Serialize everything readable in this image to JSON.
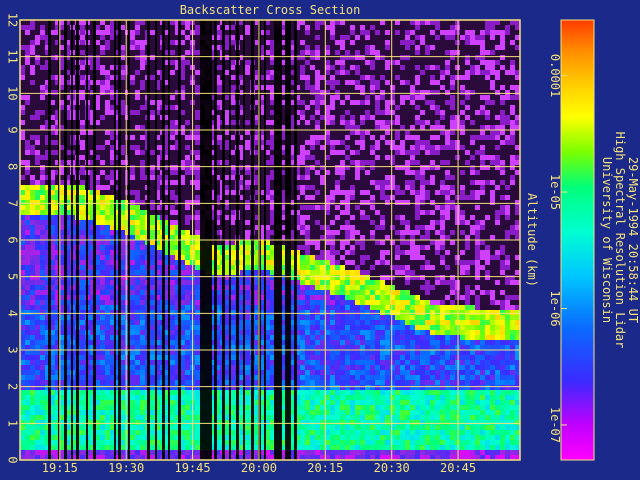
{
  "chart_data": {
    "type": "heatmap",
    "title": "Backscatter Cross Section",
    "ylabel": "Altitude (km)",
    "y_ticks": [
      "0",
      "1",
      "2",
      "3",
      "4",
      "5",
      "6",
      "7",
      "8",
      "9",
      "10",
      "11",
      "12"
    ],
    "ylim": [
      0,
      12
    ],
    "x_ticks": [
      "19:15",
      "19:30",
      "19:45",
      "20:00",
      "20:15",
      "20:30",
      "20:45"
    ],
    "x_tick_minutes": [
      1155,
      1170,
      1185,
      1200,
      1215,
      1230,
      1245
    ],
    "xlim_minutes": [
      1146,
      1259
    ],
    "grid": true,
    "colorbar": {
      "scale": "log",
      "range": [
        5e-08,
        0.0003
      ],
      "tick_labels": [
        "0.0001",
        "1e-05",
        "1e-06",
        "1e-07"
      ],
      "tick_values": [
        0.0001,
        1e-05,
        1e-06,
        1e-07
      ],
      "colormap": [
        "#ff00ff",
        "#8a2be2",
        "#3a2bff",
        "#0a6aff",
        "#00c8ff",
        "#00ffd0",
        "#00ff7a",
        "#7aff00",
        "#ffff00",
        "#ffc800",
        "#ff8c00",
        "#ff3c00"
      ]
    },
    "cloud_layer_top_km": [
      {
        "time": "19:10",
        "km": 7.3
      },
      {
        "time": "19:20",
        "km": 7.2
      },
      {
        "time": "19:30",
        "km": 6.8
      },
      {
        "time": "19:40",
        "km": 6.2
      },
      {
        "time": "19:50",
        "km": 5.6
      },
      {
        "time": "20:00",
        "km": 5.8
      },
      {
        "time": "20:10",
        "km": 5.4
      },
      {
        "time": "20:20",
        "km": 5.0
      },
      {
        "time": "20:30",
        "km": 4.5
      },
      {
        "time": "20:40",
        "km": 4.0
      },
      {
        "time": "20:50",
        "km": 3.9
      }
    ],
    "boundary_layer_top_km": 1.9
  },
  "institution": {
    "line1": "University of Wisconsin",
    "line2": "High Spectral Resolution Lidar",
    "line3": "29-May-1994 20:58:44 UT"
  },
  "colors": {
    "background": "#1b2a8a",
    "grid": "#f4e27a",
    "text": "#f4e27a",
    "noise_low": "#2a0a3a",
    "noise_high": "#ff40ff"
  }
}
